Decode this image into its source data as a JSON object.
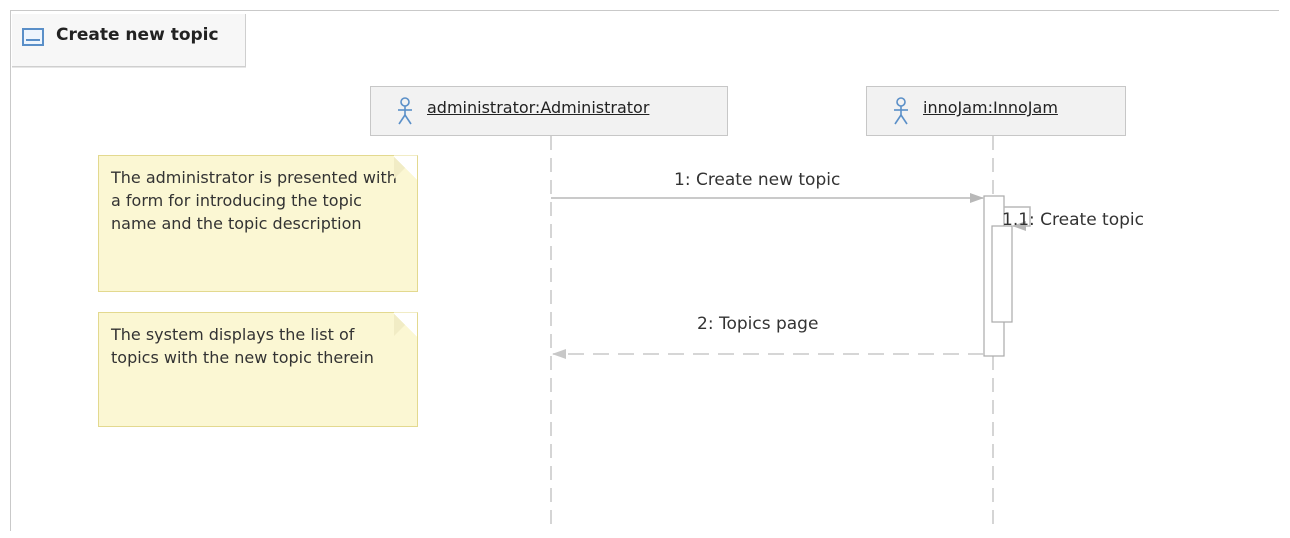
{
  "frame": {
    "title": "Create new topic"
  },
  "lifelines": [
    {
      "name": "administrator:Administrator"
    },
    {
      "name": "innoJam:InnoJam"
    }
  ],
  "messages": [
    {
      "label": "1: Create new topic"
    },
    {
      "label": "1.1: Create topic"
    },
    {
      "label": "2: Topics page"
    }
  ],
  "notes": [
    {
      "text": "The administrator is presented with a form for introducing the topic name and the topic description"
    },
    {
      "text": "The system displays the list of topics with the new topic therein"
    }
  ],
  "colors": {
    "note_fill": "#fbf7d3",
    "lifeline_head_fill": "#f2f2f2",
    "icon_blue": "#5a8fc8"
  }
}
